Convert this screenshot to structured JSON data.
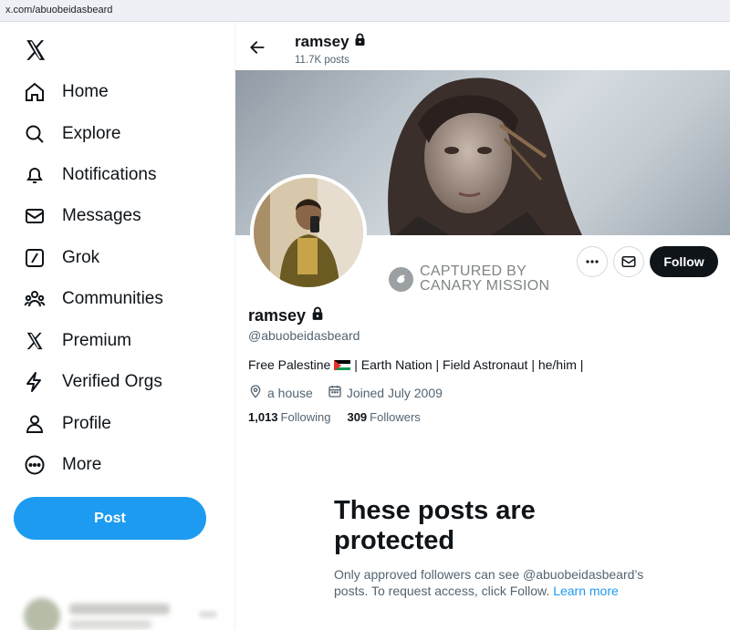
{
  "browser": {
    "url": "x.com/abuobeidasbeard"
  },
  "sidebar": {
    "logo_icon": "x-logo-icon",
    "items": [
      {
        "label": "Home",
        "icon": "home-icon"
      },
      {
        "label": "Explore",
        "icon": "search-icon"
      },
      {
        "label": "Notifications",
        "icon": "bell-icon"
      },
      {
        "label": "Messages",
        "icon": "envelope-icon"
      },
      {
        "label": "Grok",
        "icon": "grok-icon"
      },
      {
        "label": "Communities",
        "icon": "communities-icon"
      },
      {
        "label": "Premium",
        "icon": "x-logo-icon"
      },
      {
        "label": "Verified Orgs",
        "icon": "lightning-icon"
      },
      {
        "label": "Profile",
        "icon": "person-icon"
      },
      {
        "label": "More",
        "icon": "more-circle-icon"
      }
    ],
    "post_label": "Post"
  },
  "header": {
    "name": "ramsey",
    "post_count": "11.7K posts"
  },
  "profile": {
    "name": "ramsey",
    "handle": "@abuobeidasbeard",
    "bio_before": "Free Palestine",
    "bio_after": "| Earth Nation | Field Astronaut | he/him |",
    "location": "a house",
    "joined": "Joined July 2009",
    "following_count": "1,013",
    "following_label": "Following",
    "followers_count": "309",
    "followers_label": "Followers",
    "follow_label": "Follow"
  },
  "watermark": {
    "line1": "CAPTURED BY",
    "line2": "CANARY MISSION"
  },
  "protected": {
    "title": "These posts are protected",
    "body": "Only approved followers can see @abuobeidasbeard’s posts. To request access, click Follow.",
    "link": "Learn more"
  },
  "colors": {
    "accent": "#1d9bf0",
    "text": "#0f1419",
    "secondary": "#536471"
  }
}
